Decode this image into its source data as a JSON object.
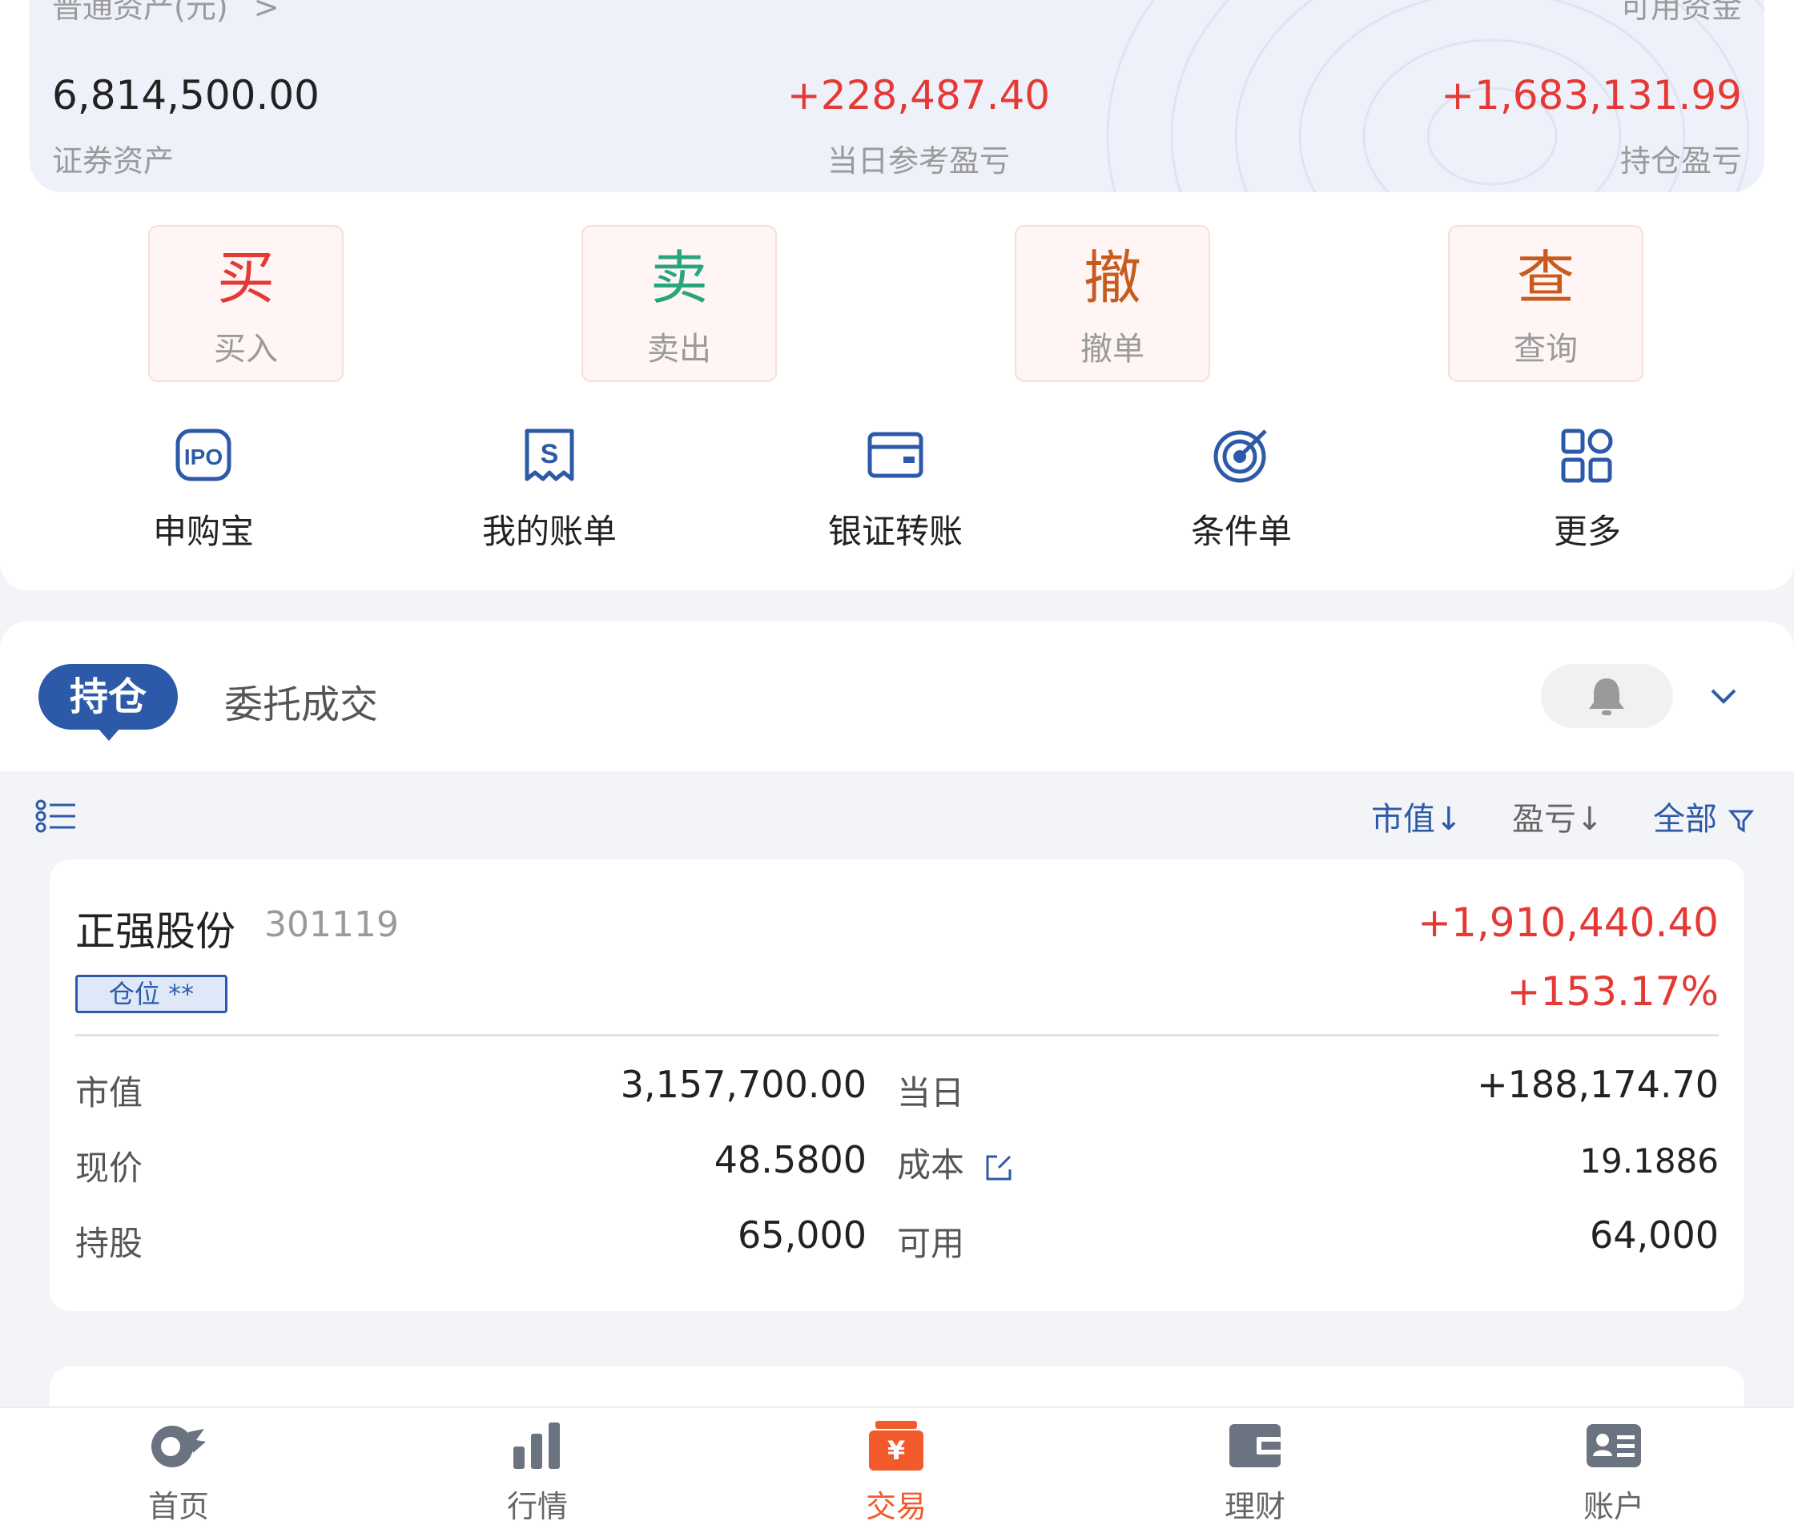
{
  "assets": {
    "header_left": "普通资产(元)",
    "header_arrow": ">",
    "header_right": "可用资金",
    "securities_value": "6,814,500.00",
    "securities_label": "证券资产",
    "daily_pl_value": "+228,487.40",
    "daily_pl_label": "当日参考盈亏",
    "position_pl_value": "+1,683,131.99",
    "position_pl_label": "持仓盈亏"
  },
  "actions": [
    {
      "big": "买",
      "small": "买入",
      "color": "#e53935"
    },
    {
      "big": "卖",
      "small": "卖出",
      "color": "#27a67e"
    },
    {
      "big": "撤",
      "small": "撤单",
      "color": "#c85a1e"
    },
    {
      "big": "查",
      "small": "查询",
      "color": "#c85a1e"
    }
  ],
  "shortcuts": [
    {
      "label": "申购宝",
      "icon": "ipo-icon",
      "icon_text": "IPO"
    },
    {
      "label": "我的账单",
      "icon": "bill-icon",
      "icon_text": "S"
    },
    {
      "label": "银证转账",
      "icon": "card-icon"
    },
    {
      "label": "条件单",
      "icon": "target-icon"
    },
    {
      "label": "更多",
      "icon": "grid-icon"
    }
  ],
  "tabs": {
    "active": "持仓",
    "inactive": "委托成交"
  },
  "sort": {
    "market_value": "市值↓",
    "pl": "盈亏↓",
    "all": "全部"
  },
  "stock": {
    "name": "正强股份",
    "code": "301119",
    "badge": "仓位 **",
    "pl_value": "+1,910,440.40",
    "pl_pct": "+153.17%",
    "rows": [
      {
        "l1": "市值",
        "v1": "3,157,700.00",
        "l2": "当日",
        "v2": "+188,174.70"
      },
      {
        "l1": "现价",
        "v1": "48.5800",
        "l2": "成本",
        "v2": "19.1886"
      },
      {
        "l1": "持股",
        "v1": "65,000",
        "l2": "可用",
        "v2": "64,000"
      }
    ]
  },
  "nav": [
    {
      "label": "首页",
      "icon": "home-icon"
    },
    {
      "label": "行情",
      "icon": "market-icon"
    },
    {
      "label": "交易",
      "icon": "trade-icon",
      "icon_text": "¥"
    },
    {
      "label": "理财",
      "icon": "wallet-icon"
    },
    {
      "label": "账户",
      "icon": "account-icon"
    }
  ],
  "colors": {
    "accent": "#2d5aa8",
    "up": "#e53935",
    "trade_active": "#f25a2b"
  }
}
